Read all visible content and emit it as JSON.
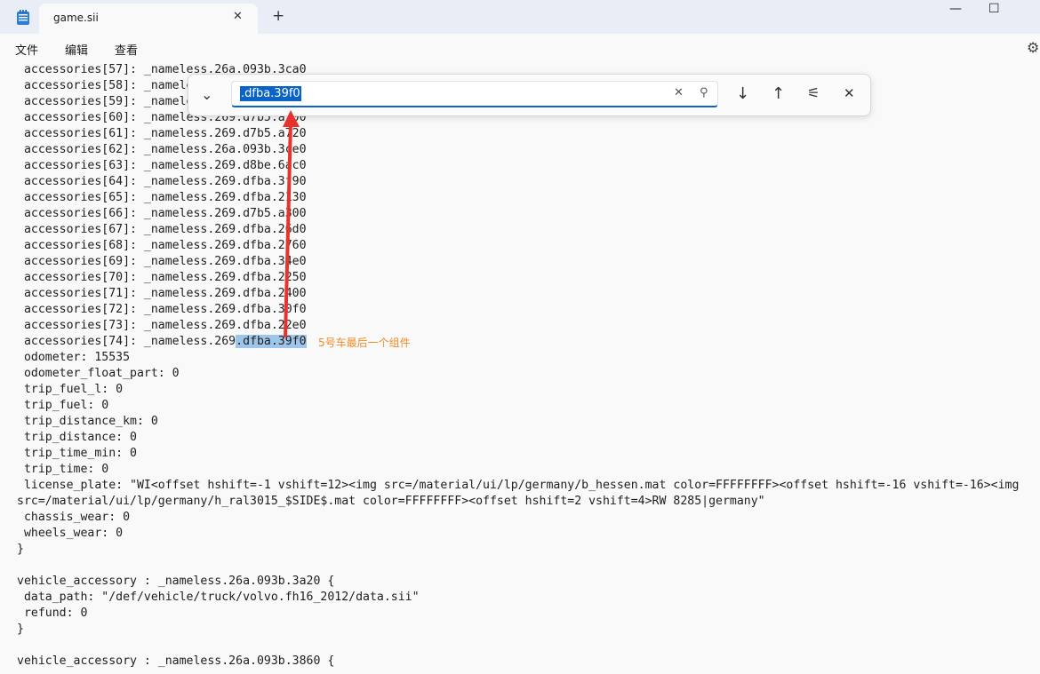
{
  "tab": {
    "title": "game.sii",
    "close_glyph": "✕",
    "new_glyph": "+"
  },
  "window": {
    "minimize": "—",
    "maximize": "☐"
  },
  "menu": {
    "file": "文件",
    "edit": "编辑",
    "view": "查看"
  },
  "find": {
    "query": ".dfba.39f0",
    "toggle_glyph": "⌄",
    "clear_glyph": "✕",
    "search_glyph": "⚲",
    "next_glyph": "↓",
    "prev_glyph": "↑",
    "options_glyph": "⚟",
    "close_glyph": "✕"
  },
  "editor": {
    "lines": [
      " accessories[57]: _nameless.26a.093b.3ca0",
      " accessories[58]: _nameless.26a.093b.3c80",
      " accessories[59]: _nameless.26a.093b.3c60",
      " accessories[60]: _nameless.269.d7b5.a700",
      " accessories[61]: _nameless.269.d7b5.a720",
      " accessories[62]: _nameless.26a.093b.3ce0",
      " accessories[63]: _nameless.269.d8be.6ac0",
      " accessories[64]: _nameless.269.dfba.3f90",
      " accessories[65]: _nameless.269.dfba.2130",
      " accessories[66]: _nameless.269.d7b5.a300",
      " accessories[67]: _nameless.269.dfba.26d0",
      " accessories[68]: _nameless.269.dfba.2760",
      " accessories[69]: _nameless.269.dfba.34e0",
      " accessories[70]: _nameless.269.dfba.2250",
      " accessories[71]: _nameless.269.dfba.2400",
      " accessories[72]: _nameless.269.dfba.30f0",
      " accessories[73]: _nameless.269.dfba.22e0"
    ],
    "line74_prefix": " accessories[74]: _nameless.269",
    "line74_match": ".dfba.39f0",
    "annotation": "5号车最后一个组件",
    "lines_after": [
      " odometer: 15535",
      " odometer_float_part: 0",
      " trip_fuel_l: 0",
      " trip_fuel: 0",
      " trip_distance_km: 0",
      " trip_distance: 0",
      " trip_time_min: 0",
      " trip_time: 0",
      " license_plate: \"WI<offset hshift=-1 vshift=12><img src=/material/ui/lp/germany/b_hessen.mat color=FFFFFFFF><offset hshift=-16 vshift=-16><img",
      "src=/material/ui/lp/germany/h_ral3015_$SIDE$.mat color=FFFFFFFF><offset hshift=2 vshift=4>RW 8285|germany\"",
      " chassis_wear: 0",
      " wheels_wear: 0",
      "}",
      "",
      "vehicle_accessory : _nameless.26a.093b.3a20 {",
      " data_path: \"/def/vehicle/truck/volvo.fh16_2012/data.sii\"",
      " refund: 0",
      "}",
      "",
      "vehicle_accessory : _nameless.26a.093b.3860 {"
    ]
  },
  "colors": {
    "accent": "#0a64c8",
    "match_highlight": "#9ec6ea",
    "annotation": "#f08c28",
    "arrow": "#e8322d"
  }
}
